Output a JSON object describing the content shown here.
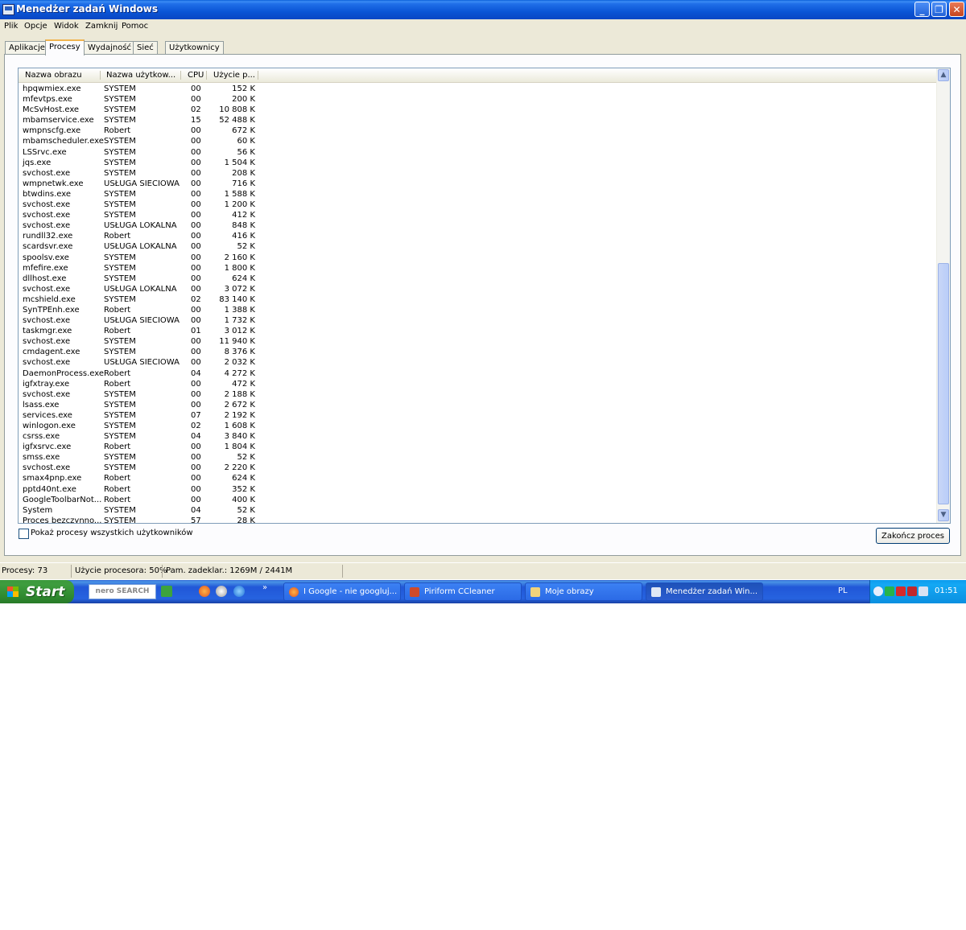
{
  "window": {
    "title": "Menedżer zadań Windows",
    "minimize": "_",
    "maximize": "❐",
    "close": "✕"
  },
  "menu": [
    "Plik",
    "Opcje",
    "Widok",
    "Zamknij",
    "Pomoc"
  ],
  "tabs": [
    "Aplikacje",
    "Procesy",
    "Wydajność",
    "Sieć",
    "Użytkownicy"
  ],
  "active_tab": "Procesy",
  "columns": [
    "Nazwa obrazu",
    "Nazwa użytkow...",
    "CPU",
    "Użycie p..."
  ],
  "processes": [
    [
      "hpqwmiex.exe",
      "SYSTEM",
      "00",
      "152 K"
    ],
    [
      "mfevtps.exe",
      "SYSTEM",
      "00",
      "200 K"
    ],
    [
      "McSvHost.exe",
      "SYSTEM",
      "02",
      "10 808 K"
    ],
    [
      "mbamservice.exe",
      "SYSTEM",
      "15",
      "52 488 K"
    ],
    [
      "wmpnscfg.exe",
      "Robert",
      "00",
      "672 K"
    ],
    [
      "mbamscheduler.exe",
      "SYSTEM",
      "00",
      "60 K"
    ],
    [
      "LSSrvc.exe",
      "SYSTEM",
      "00",
      "56 K"
    ],
    [
      "jqs.exe",
      "SYSTEM",
      "00",
      "1 504 K"
    ],
    [
      "svchost.exe",
      "SYSTEM",
      "00",
      "208 K"
    ],
    [
      "wmpnetwk.exe",
      "USŁUGA SIECIOWA",
      "00",
      "716 K"
    ],
    [
      "btwdins.exe",
      "SYSTEM",
      "00",
      "1 588 K"
    ],
    [
      "svchost.exe",
      "SYSTEM",
      "00",
      "1 200 K"
    ],
    [
      "svchost.exe",
      "SYSTEM",
      "00",
      "412 K"
    ],
    [
      "svchost.exe",
      "USŁUGA LOKALNA",
      "00",
      "848 K"
    ],
    [
      "rundll32.exe",
      "Robert",
      "00",
      "416 K"
    ],
    [
      "scardsvr.exe",
      "USŁUGA LOKALNA",
      "00",
      "52 K"
    ],
    [
      "spoolsv.exe",
      "SYSTEM",
      "00",
      "2 160 K"
    ],
    [
      "mfefire.exe",
      "SYSTEM",
      "00",
      "1 800 K"
    ],
    [
      "dllhost.exe",
      "SYSTEM",
      "00",
      "624 K"
    ],
    [
      "svchost.exe",
      "USŁUGA LOKALNA",
      "00",
      "3 072 K"
    ],
    [
      "mcshield.exe",
      "SYSTEM",
      "02",
      "83 140 K"
    ],
    [
      "SynTPEnh.exe",
      "Robert",
      "00",
      "1 388 K"
    ],
    [
      "svchost.exe",
      "USŁUGA SIECIOWA",
      "00",
      "1 732 K"
    ],
    [
      "taskmgr.exe",
      "Robert",
      "01",
      "3 012 K"
    ],
    [
      "svchost.exe",
      "SYSTEM",
      "00",
      "11 940 K"
    ],
    [
      "cmdagent.exe",
      "SYSTEM",
      "00",
      "8 376 K"
    ],
    [
      "svchost.exe",
      "USŁUGA SIECIOWA",
      "00",
      "2 032 K"
    ],
    [
      "DaemonProcess.exe",
      "Robert",
      "04",
      "4 272 K"
    ],
    [
      "igfxtray.exe",
      "Robert",
      "00",
      "472 K"
    ],
    [
      "svchost.exe",
      "SYSTEM",
      "00",
      "2 188 K"
    ],
    [
      "lsass.exe",
      "SYSTEM",
      "00",
      "2 672 K"
    ],
    [
      "services.exe",
      "SYSTEM",
      "07",
      "2 192 K"
    ],
    [
      "winlogon.exe",
      "SYSTEM",
      "02",
      "1 608 K"
    ],
    [
      "csrss.exe",
      "SYSTEM",
      "04",
      "3 840 K"
    ],
    [
      "igfxsrvc.exe",
      "Robert",
      "00",
      "1 804 K"
    ],
    [
      "smss.exe",
      "SYSTEM",
      "00",
      "52 K"
    ],
    [
      "svchost.exe",
      "SYSTEM",
      "00",
      "2 220 K"
    ],
    [
      "smax4pnp.exe",
      "Robert",
      "00",
      "624 K"
    ],
    [
      "pptd40nt.exe",
      "Robert",
      "00",
      "352 K"
    ],
    [
      "GoogleToolbarNot...",
      "Robert",
      "00",
      "400 K"
    ],
    [
      "System",
      "SYSTEM",
      "04",
      "52 K"
    ],
    [
      "Proces bezczynno...",
      "SYSTEM",
      "57",
      "28 K"
    ]
  ],
  "show_all_label": "Pokaż procesy wszystkich użytkowników",
  "end_process_label": "Zakończ proces",
  "status": {
    "processes": "Procesy: 73",
    "cpu": "Użycie procesora: 50%",
    "commit": "Pam. zadeklar.: 1269M / 2441M"
  },
  "taskbar": {
    "start": "Start",
    "search_brand": "nero SEARCH",
    "overflow": "»",
    "tasks": [
      "I Google - nie googluj...",
      "Piriform CCleaner",
      "Moje obrazy",
      "Menedżer zadań Win..."
    ],
    "active_task": "Menedżer zadań Win...",
    "language": "PL",
    "clock": "01:51"
  },
  "colors": {
    "titlebar": "#0b55d6",
    "taskbar": "#2157d7",
    "start_button": "#3e9c3e",
    "tray": "#0c9ced",
    "active_tab_accent": "#f1b44f"
  }
}
